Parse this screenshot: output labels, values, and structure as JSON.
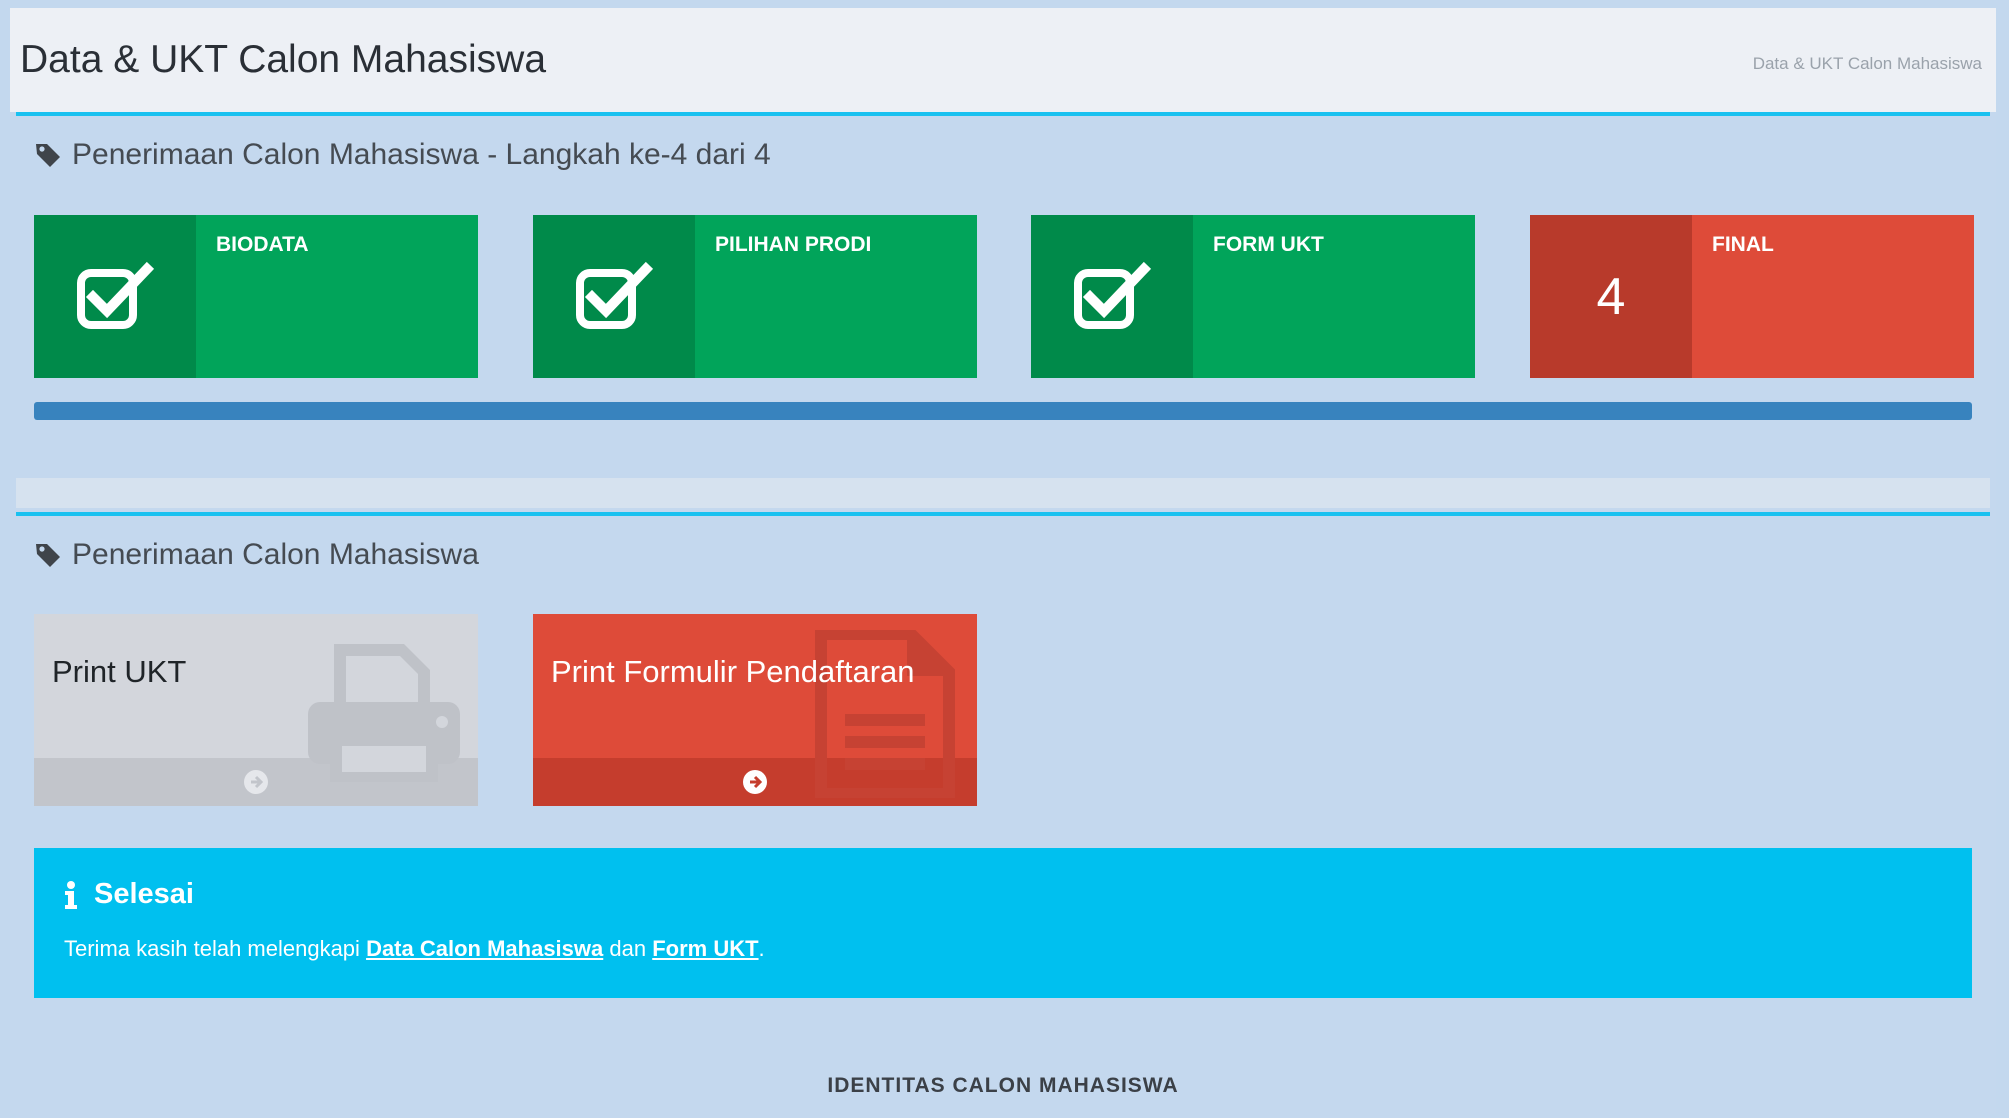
{
  "header": {
    "title": "Data & UKT Calon Mahasiswa",
    "breadcrumb": "Data & UKT Calon Mahasiswa"
  },
  "steps_box": {
    "title": "Penerimaan Calon Mahasiswa - Langkah ke-4 dari 4",
    "steps": [
      {
        "label": "BIODATA",
        "icon": "check-square-icon",
        "status": "done"
      },
      {
        "label": "PILIHAN PRODI",
        "icon": "check-square-icon",
        "status": "done"
      },
      {
        "label": "FORM UKT",
        "icon": "check-square-icon",
        "status": "done"
      },
      {
        "label": "FINAL",
        "number": "4",
        "status": "current"
      }
    ],
    "progress_percent": 100
  },
  "actions_box": {
    "title": "Penerimaan Calon Mahasiswa",
    "tiles": [
      {
        "title": "Print UKT",
        "icon": "printer-icon",
        "footer_icon": "arrow-circle-right-icon"
      },
      {
        "title": "Print Formulir Pendaftaran",
        "icon": "document-icon",
        "footer_icon": "arrow-circle-right-icon"
      }
    ],
    "callout": {
      "title": "Selesai",
      "text_before": "Terima kasih telah melengkapi",
      "link1": "Data Calon Mahasiswa",
      "text_middle": "dan",
      "link2": "Form UKT",
      "text_after": "."
    },
    "section_heading": "IDENTITAS CALON MAHASISWA"
  },
  "colors": {
    "green": "#01a45a",
    "green_dark": "#008a4a",
    "red": "#de4b39",
    "red_dark": "#b83a2b",
    "info": "#00c0ef",
    "progress": "#3883be",
    "box_border": "#19c1f0"
  }
}
